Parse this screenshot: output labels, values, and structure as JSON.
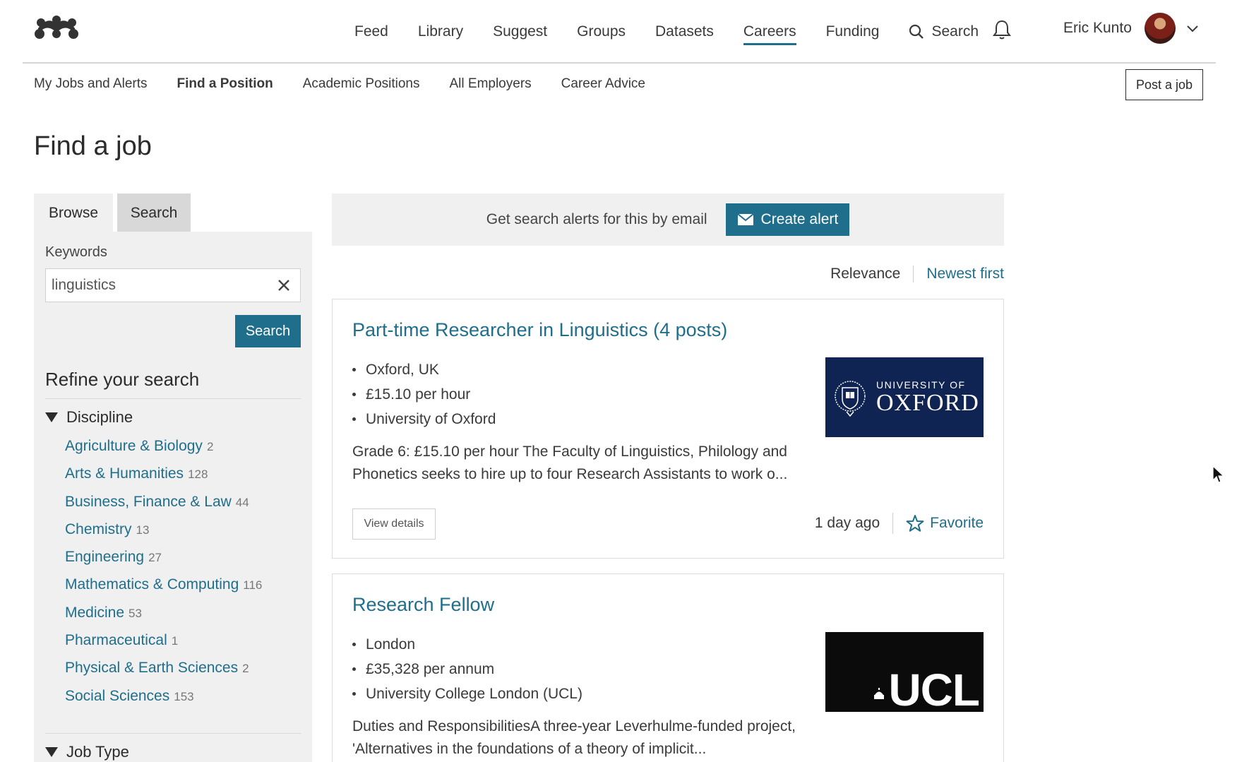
{
  "topnav": {
    "items": [
      {
        "label": "Feed"
      },
      {
        "label": "Library"
      },
      {
        "label": "Suggest"
      },
      {
        "label": "Groups"
      },
      {
        "label": "Datasets"
      },
      {
        "label": "Careers"
      },
      {
        "label": "Funding"
      }
    ],
    "active": "Careers",
    "search_label": "Search",
    "user_name": "Eric Kunto"
  },
  "subnav": {
    "items": [
      "My Jobs and Alerts",
      "Find a Position",
      "Academic Positions",
      "All Employers",
      "Career Advice"
    ],
    "active": "Find a Position",
    "post_job": "Post a job"
  },
  "page": {
    "title": "Find a job"
  },
  "sidebar": {
    "tabs": [
      "Browse",
      "Search"
    ],
    "active_tab": "Search",
    "keywords_label": "Keywords",
    "keywords_value": "linguistics",
    "search_button": "Search",
    "refine_title": "Refine your search",
    "discipline_title": "Discipline",
    "disciplines": [
      {
        "name": "Agriculture & Biology",
        "count": "2"
      },
      {
        "name": "Arts & Humanities",
        "count": "128"
      },
      {
        "name": "Business, Finance & Law",
        "count": "44"
      },
      {
        "name": "Chemistry",
        "count": "13"
      },
      {
        "name": "Engineering",
        "count": "27"
      },
      {
        "name": "Mathematics & Computing",
        "count": "116"
      },
      {
        "name": "Medicine",
        "count": "53"
      },
      {
        "name": "Pharmaceutical",
        "count": "1"
      },
      {
        "name": "Physical & Earth Sciences",
        "count": "2"
      },
      {
        "name": "Social Sciences",
        "count": "153"
      }
    ],
    "job_type_title": "Job Type"
  },
  "alert": {
    "text": "Get search alerts for this by email",
    "button": "Create alert"
  },
  "sort": {
    "relevance": "Relevance",
    "newest": "Newest first"
  },
  "jobs": [
    {
      "title": "Part-time Researcher in Linguistics (4 posts)",
      "location": "Oxford, UK",
      "salary": "£15.10 per hour",
      "employer": "University of Oxford",
      "description": "Grade 6: £15.10 per hour The Faculty of Linguistics, Philology and Phonetics seeks to hire up to four Research Assistants to work o...",
      "logo_line1": "UNIVERSITY OF",
      "logo_line2": "OXFORD",
      "view_details": "View details",
      "posted": "1 day ago",
      "favorite": "Favorite"
    },
    {
      "title": "Research Fellow",
      "location": "London",
      "salary": "£35,328 per annum",
      "employer": "University College London (UCL)",
      "description": "Duties and ResponsibilitiesA three-year Leverhulme-funded project, 'Alternatives in the foundations of a theory of implicit...",
      "logo_text": "UCL"
    }
  ],
  "colors": {
    "accent": "#1f6e8c",
    "oxford_blue": "#0f2452"
  }
}
